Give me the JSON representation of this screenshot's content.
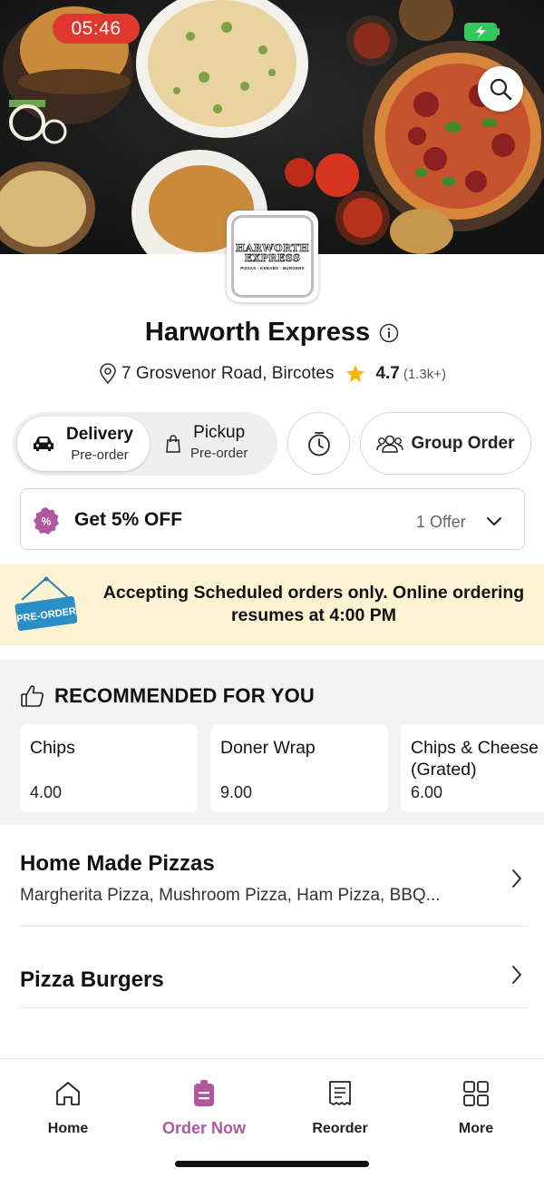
{
  "status_bar": {
    "time": "05:46"
  },
  "restaurant": {
    "name": "Harworth Express",
    "address": "7 Grosvenor Road, Bircotes",
    "rating": "4.7",
    "rating_count": "(1.3k+)",
    "logo": {
      "line1": "HARWORTH",
      "line2": "EXPRESS",
      "line3": "PIZZAS - KEBABS - BURGERS"
    }
  },
  "order_types": [
    {
      "title": "Delivery",
      "subtitle": "Pre-order",
      "selected": true,
      "icon": "car-icon"
    },
    {
      "title": "Pickup",
      "subtitle": "Pre-order",
      "selected": false,
      "icon": "shopping-bag-icon"
    }
  ],
  "schedule_icon": "timer-icon",
  "group_order": {
    "label": "Group Order",
    "icon": "group-icon"
  },
  "offer": {
    "title": "Get 5% OFF",
    "count": "1 Offer",
    "icon": "discount-badge-icon"
  },
  "banner": {
    "sign_text": "PRE-ORDER",
    "message": "Accepting Scheduled orders only. Online ordering resumes at 4:00 PM"
  },
  "recommended": {
    "title": "RECOMMENDED FOR YOU",
    "items": [
      {
        "name": "Chips",
        "price": "4.00"
      },
      {
        "name": "Doner Wrap",
        "price": "9.00"
      },
      {
        "name": "Chips & Cheese (Grated)",
        "price": "6.00"
      }
    ]
  },
  "categories": [
    {
      "title": "Home Made Pizzas",
      "subtitle": "Margherita Pizza, Mushroom Pizza, Ham Pizza, BBQ..."
    },
    {
      "title": "Pizza Burgers",
      "subtitle": ""
    }
  ],
  "nav": {
    "active": "Order Now",
    "items": [
      {
        "label": "Home",
        "icon": "home-icon"
      },
      {
        "label": "Order Now",
        "icon": "order-icon"
      },
      {
        "label": "Reorder",
        "icon": "receipt-icon"
      },
      {
        "label": "More",
        "icon": "grid-icon"
      }
    ]
  },
  "colors": {
    "accent": "#b0589f",
    "banner_bg": "#fdf3d2",
    "star": "#f5b400",
    "time_pill": "#e0382e",
    "battery": "#34c759"
  }
}
